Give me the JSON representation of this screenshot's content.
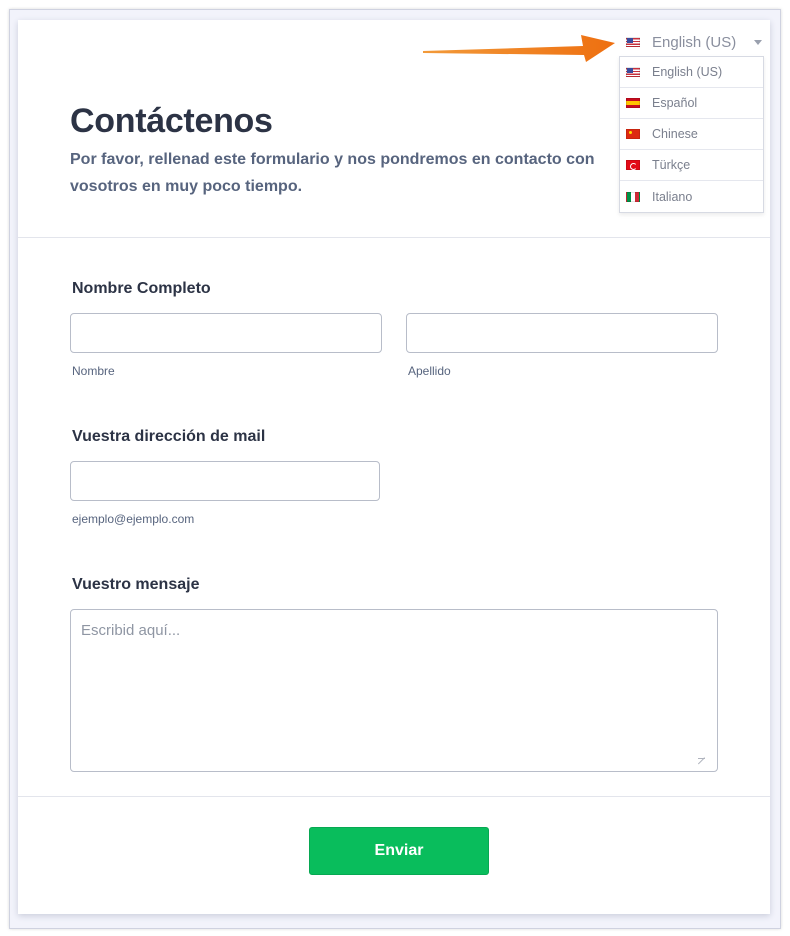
{
  "header": {
    "title": "Contáctenos",
    "subtitle": "Por favor, rellenad este formulario y nos pondremos en contacto con vosotros en muy poco tiempo."
  },
  "language": {
    "selected": "English (US)",
    "options": [
      {
        "label": "English (US)",
        "flag": "us-flag-icon"
      },
      {
        "label": "Español",
        "flag": "spain-flag-icon"
      },
      {
        "label": "Chinese",
        "flag": "china-flag-icon"
      },
      {
        "label": "Türkçe",
        "flag": "turkey-flag-icon"
      },
      {
        "label": "Italiano",
        "flag": "italy-flag-icon"
      }
    ]
  },
  "form": {
    "full_name": {
      "label": "Nombre Completo",
      "first_sublabel": "Nombre",
      "last_sublabel": "Apellido",
      "first_value": "",
      "last_value": ""
    },
    "email": {
      "label": "Vuestra dirección de mail",
      "sublabel": "ejemplo@ejemplo.com",
      "value": ""
    },
    "message": {
      "label": "Vuestro mensaje",
      "placeholder": "Escribid aquí..."
    },
    "submit_label": "Enviar"
  },
  "colors": {
    "accent_arrow": "#f07a14",
    "submit": "#09bd5c"
  }
}
